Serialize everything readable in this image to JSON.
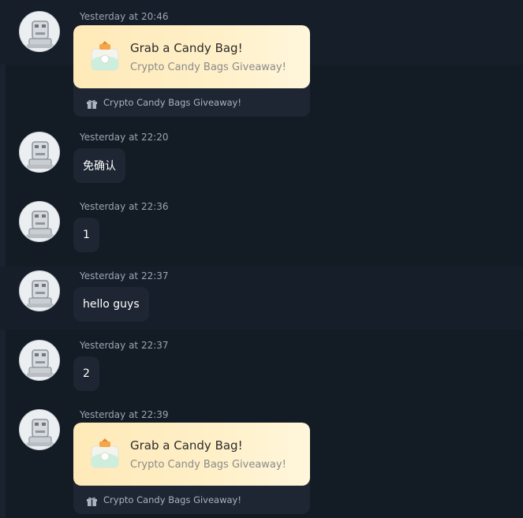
{
  "messages": [
    {
      "time": "Yesterday at 20:46",
      "type": "card",
      "card": {
        "title": "Grab a Candy Bag!",
        "subtitle": "Crypto Candy Bags Giveaway!",
        "footer": "Crypto Candy Bags Giveaway!"
      }
    },
    {
      "time": "Yesterday at 22:20",
      "type": "text",
      "text": "免确认"
    },
    {
      "time": "Yesterday at 22:36",
      "type": "text",
      "text": "1"
    },
    {
      "time": "Yesterday at 22:37",
      "type": "text",
      "text": "hello guys"
    },
    {
      "time": "Yesterday at 22:37",
      "type": "text",
      "text": "2"
    },
    {
      "time": "Yesterday at 22:39",
      "type": "card",
      "card": {
        "title": "Grab a Candy Bag!",
        "subtitle": "Crypto Candy Bags Giveaway!",
        "footer": "Crypto Candy Bags Giveaway!"
      }
    }
  ],
  "icons": {
    "avatar": "robot-avatar-icon",
    "card": "candy-bag-icon",
    "footer": "gift-icon"
  },
  "colors": {
    "background": "#131b24",
    "bubble": "#1d2632",
    "card_gradient_start": "#ffe9b8",
    "card_gradient_end": "#fff6dc"
  }
}
